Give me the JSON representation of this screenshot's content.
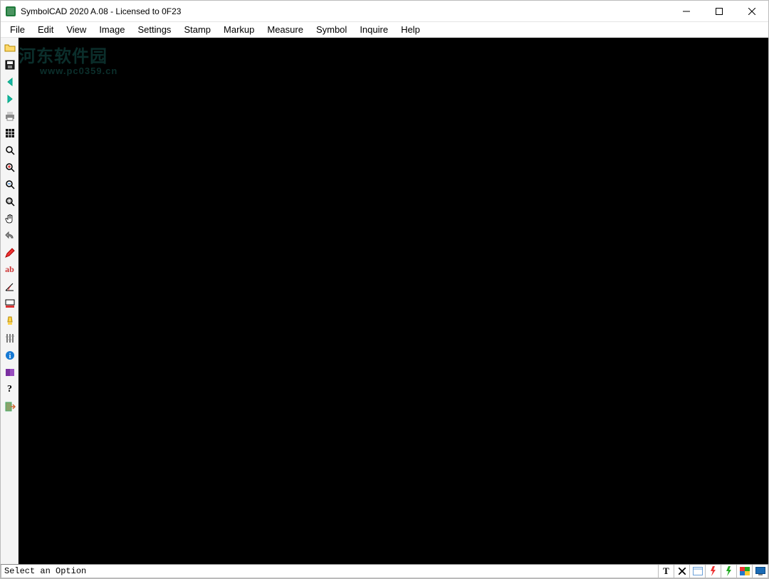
{
  "window": {
    "title": "SymbolCAD 2020 A.08 - Licensed to 0F23"
  },
  "menu": {
    "items": [
      "File",
      "Edit",
      "View",
      "Image",
      "Settings",
      "Stamp",
      "Markup",
      "Measure",
      "Symbol",
      "Inquire",
      "Help"
    ]
  },
  "toolbar": {
    "items": [
      {
        "name": "open-button"
      },
      {
        "name": "save-button"
      },
      {
        "name": "back-button"
      },
      {
        "name": "forward-button"
      },
      {
        "name": "print-button"
      },
      {
        "name": "grid-button"
      },
      {
        "name": "zoom-button"
      },
      {
        "name": "zoom-in-button"
      },
      {
        "name": "zoom-out-button"
      },
      {
        "name": "zoom-extents-button"
      },
      {
        "name": "pan-button"
      },
      {
        "name": "undo-button"
      },
      {
        "name": "pencil-button"
      },
      {
        "name": "text-button"
      },
      {
        "name": "measure-angle-button"
      },
      {
        "name": "stamp-button"
      },
      {
        "name": "highlight-button"
      },
      {
        "name": "settings-sliders-button"
      },
      {
        "name": "info-button"
      },
      {
        "name": "manual-button"
      },
      {
        "name": "help-button"
      },
      {
        "name": "exit-button"
      }
    ]
  },
  "status": {
    "text": "Select an Option"
  },
  "statusbar_tools": [
    {
      "name": "text-mode-button"
    },
    {
      "name": "close-mode-button"
    },
    {
      "name": "window-mode-button"
    },
    {
      "name": "red-flag-button"
    },
    {
      "name": "green-flag-button"
    },
    {
      "name": "palette-button"
    },
    {
      "name": "screen-button"
    }
  ],
  "watermark": {
    "line1": "河东软件园",
    "line2": "www.pc0359.cn"
  }
}
